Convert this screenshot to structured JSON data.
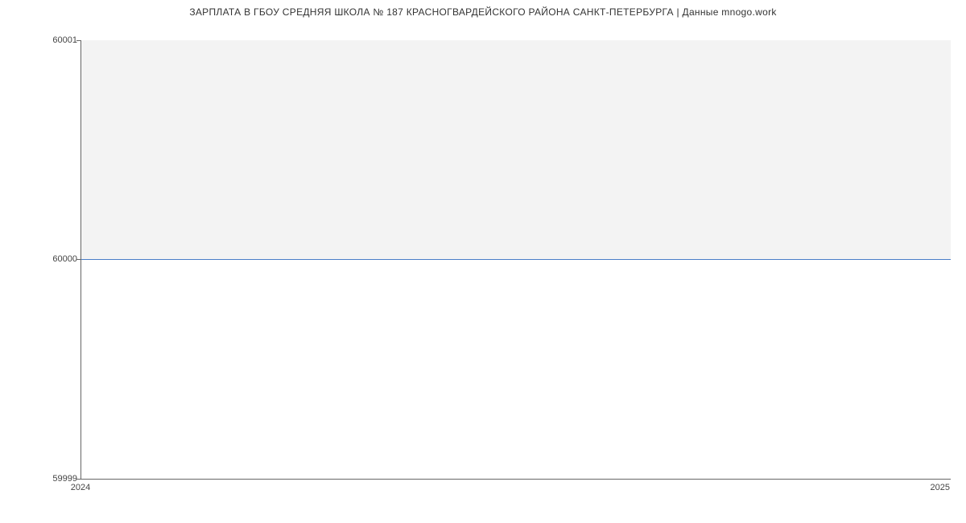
{
  "chart_data": {
    "type": "line",
    "title": "ЗАРПЛАТА В ГБОУ СРЕДНЯЯ ШКОЛА № 187 КРАСНОГВАРДЕЙСКОГО РАЙОНА САНКТ-ПЕТЕРБУРГА | Данные mnogo.work",
    "x": [
      2024,
      2025
    ],
    "values": [
      60000,
      60000
    ],
    "xlabel": "",
    "ylabel": "",
    "ylim": [
      59999,
      60001
    ],
    "xlim": [
      2024,
      2025
    ],
    "y_ticks": [
      59999,
      60000,
      60001
    ],
    "x_ticks": [
      2024,
      2025
    ],
    "fill_to_line": true,
    "fill_color": "#f3f3f3",
    "line_color": "#4a7ec8"
  }
}
